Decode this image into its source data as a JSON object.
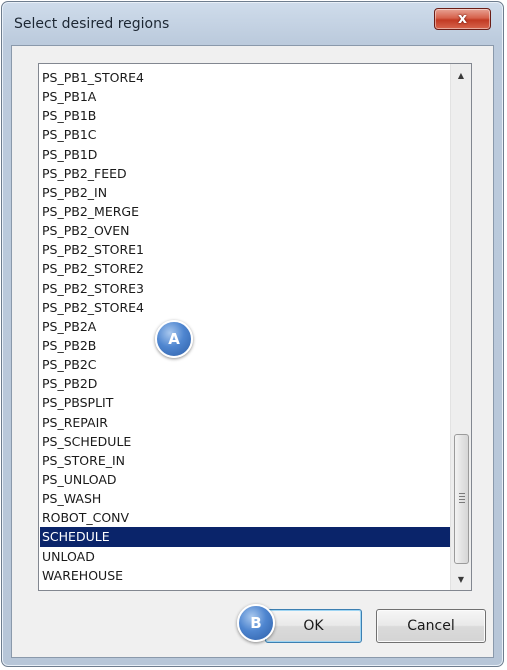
{
  "window": {
    "title": "Select desired regions",
    "close_label": "x"
  },
  "regions": {
    "items": [
      "PS_PB1_STORE4",
      "PS_PB1A",
      "PS_PB1B",
      "PS_PB1C",
      "PS_PB1D",
      "PS_PB2_FEED",
      "PS_PB2_IN",
      "PS_PB2_MERGE",
      "PS_PB2_OVEN",
      "PS_PB2_STORE1",
      "PS_PB2_STORE2",
      "PS_PB2_STORE3",
      "PS_PB2_STORE4",
      "PS_PB2A",
      "PS_PB2B",
      "PS_PB2C",
      "PS_PB2D",
      "PS_PBSPLIT",
      "PS_REPAIR",
      "PS_SCHEDULE",
      "PS_STORE_IN",
      "PS_UNLOAD",
      "PS_WASH",
      "ROBOT_CONV",
      "SCHEDULE",
      "UNLOAD",
      "WAREHOUSE"
    ],
    "selected": "SCHEDULE"
  },
  "scrollbar": {
    "up_icon": "arrow-up-icon",
    "down_icon": "arrow-down-icon"
  },
  "buttons": {
    "ok_label": "OK",
    "cancel_label": "Cancel"
  },
  "callouts": {
    "a": "A",
    "b": "B"
  },
  "colors": {
    "selection": "#0a246a",
    "close_button": "#c23a23",
    "callout": "#4f86d0"
  }
}
